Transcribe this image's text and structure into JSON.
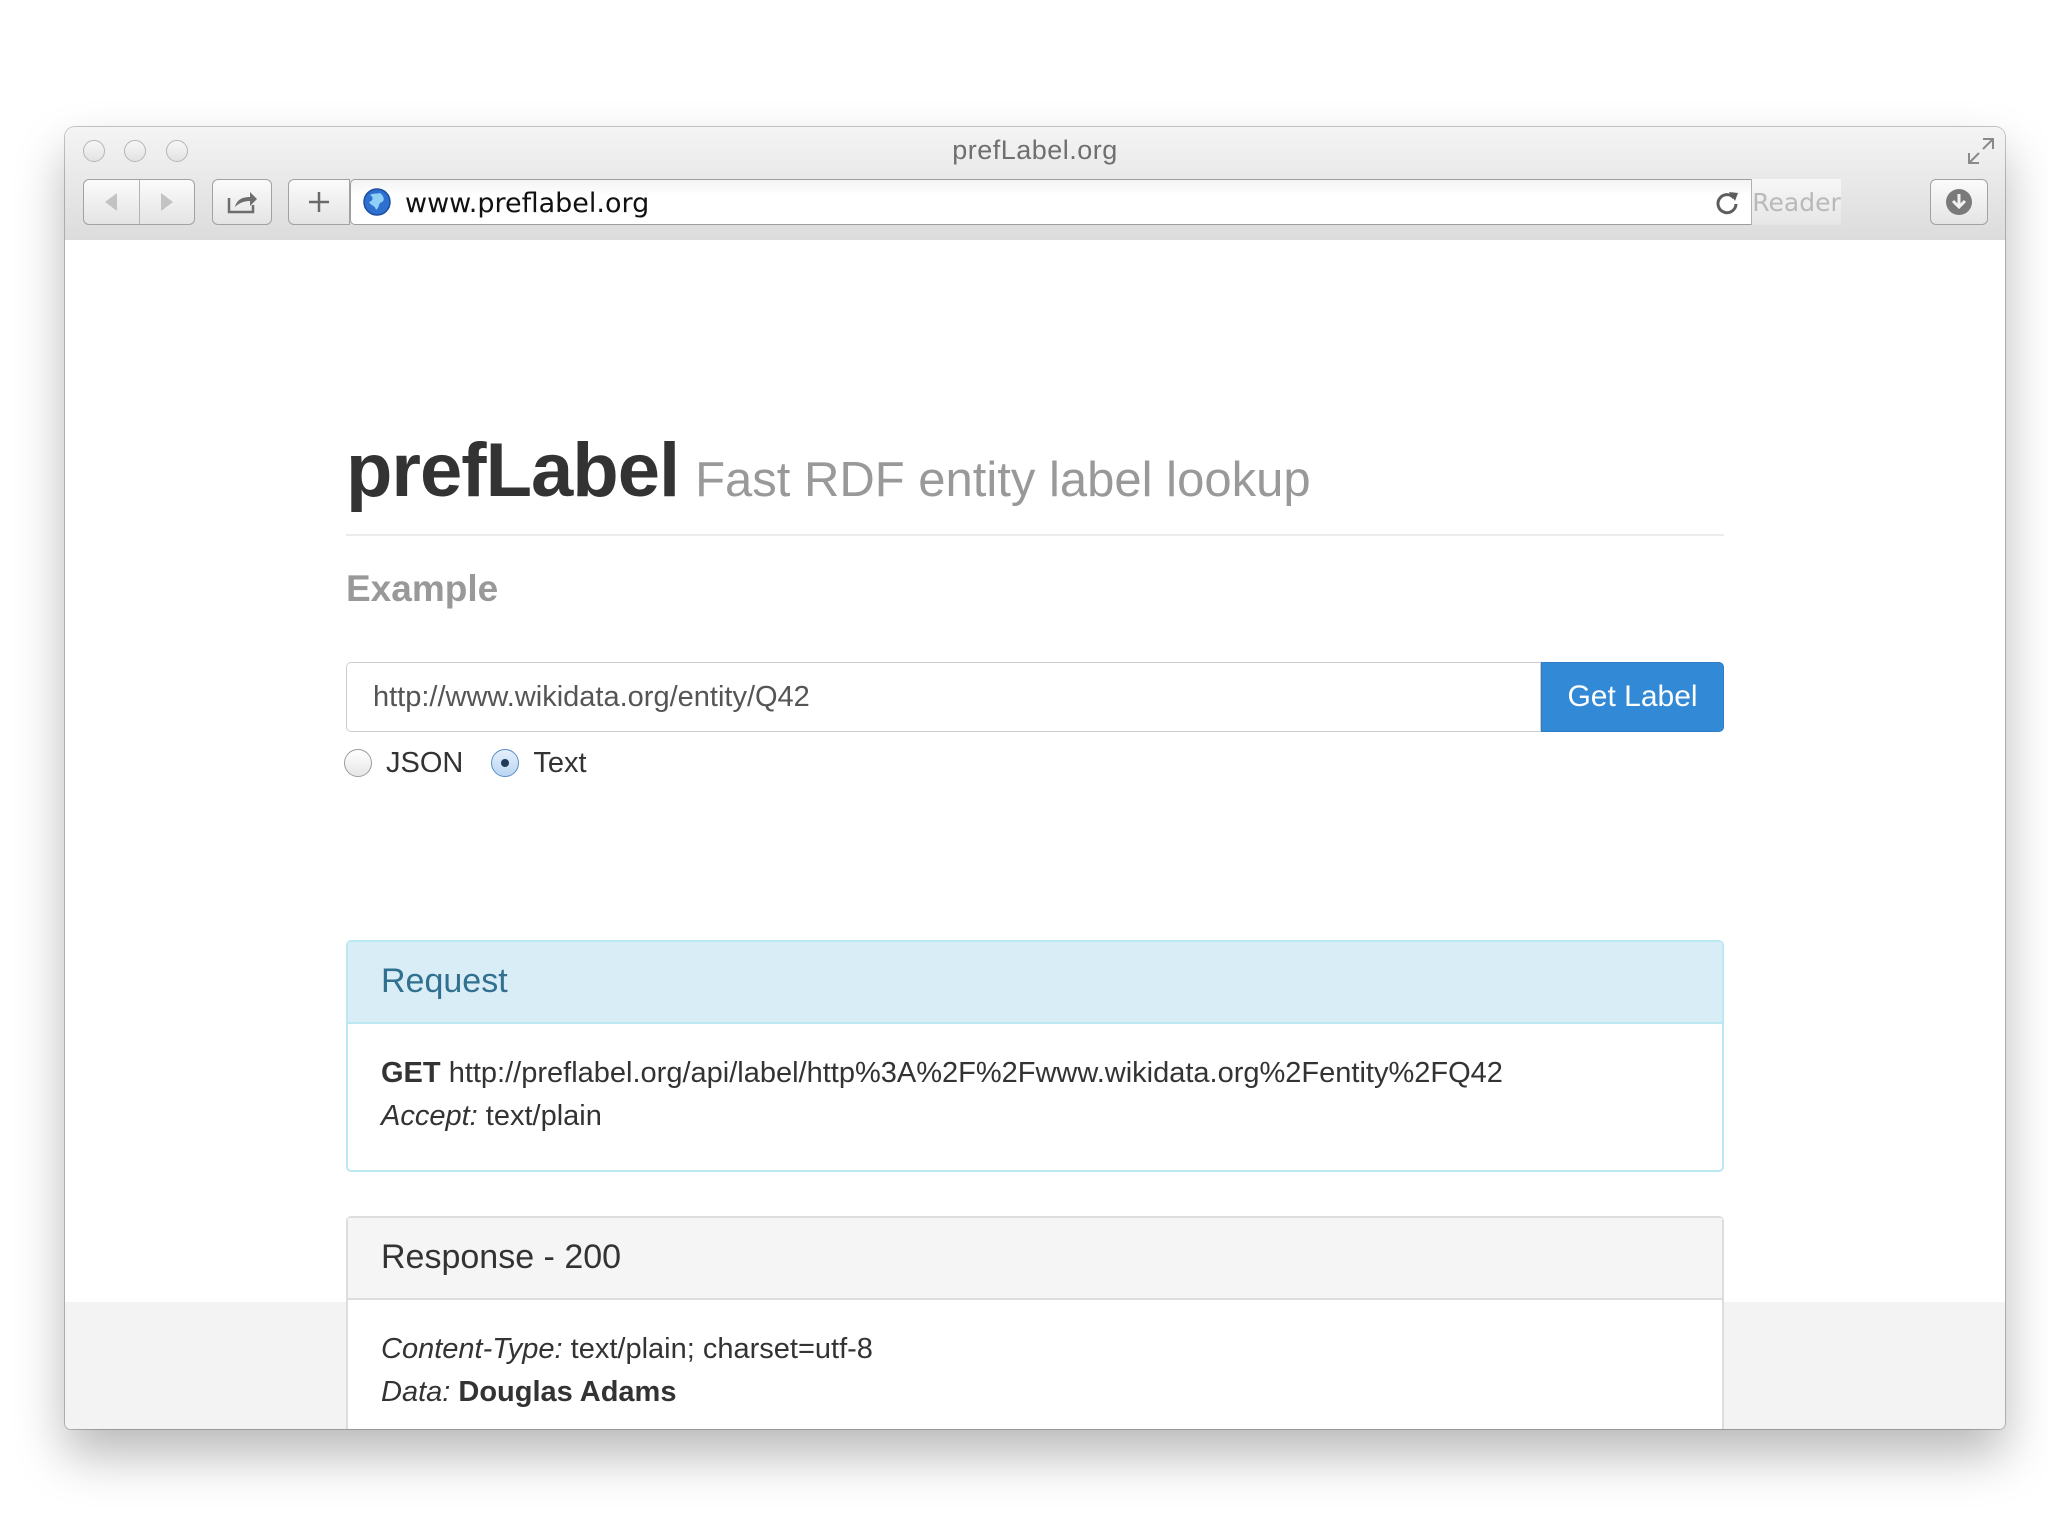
{
  "window": {
    "title": "prefLabel.org"
  },
  "toolbar": {
    "address": "www.preflabel.org",
    "reader_label": "Reader"
  },
  "page": {
    "brand": "prefLabel",
    "tagline": "Fast RDF entity label lookup",
    "example_heading": "Example",
    "input_value": "http://www.wikidata.org/entity/Q42",
    "get_button_label": "Get Label",
    "format_options": [
      {
        "label": "JSON",
        "checked": false
      },
      {
        "label": "Text",
        "checked": true
      }
    ]
  },
  "request": {
    "title": "Request",
    "method": "GET",
    "url": "http://preflabel.org/api/label/http%3A%2F%2Fwww.wikidata.org%2Fentity%2FQ42",
    "accept_key": "Accept:",
    "accept_value": "text/plain"
  },
  "response": {
    "title": "Response - 200",
    "content_type_key": "Content-Type:",
    "content_type_value": "text/plain; charset=utf-8",
    "data_key": "Data:",
    "data_value": "Douglas Adams"
  },
  "colors": {
    "primary_button": "#3289d6",
    "info_panel_heading": "#d9edf7",
    "info_panel_text": "#31708f"
  }
}
